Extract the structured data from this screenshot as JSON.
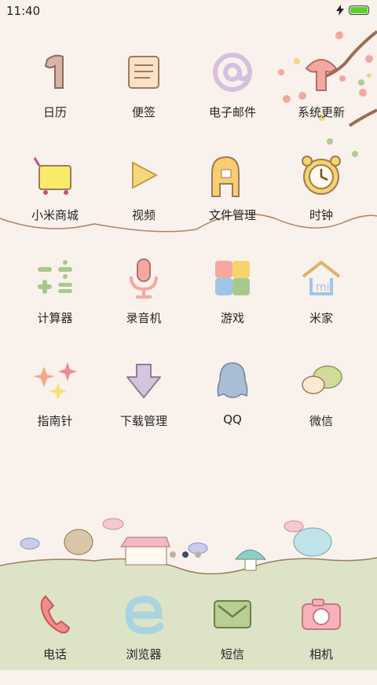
{
  "status": {
    "time": "11:40",
    "battery_level": 1.0,
    "charging": true
  },
  "pager": {
    "count": 3,
    "active_index": 1
  },
  "apps": [
    {
      "label": "日历",
      "icon": "calendar-icon"
    },
    {
      "label": "便签",
      "icon": "notes-icon"
    },
    {
      "label": "电子邮件",
      "icon": "email-icon"
    },
    {
      "label": "系统更新",
      "icon": "update-icon"
    },
    {
      "label": "小米商城",
      "icon": "mi-store-icon"
    },
    {
      "label": "视频",
      "icon": "video-icon"
    },
    {
      "label": "文件管理",
      "icon": "file-manager-icon"
    },
    {
      "label": "时钟",
      "icon": "clock-icon"
    },
    {
      "label": "计算器",
      "icon": "calculator-icon"
    },
    {
      "label": "录音机",
      "icon": "recorder-icon"
    },
    {
      "label": "游戏",
      "icon": "games-icon"
    },
    {
      "label": "米家",
      "icon": "mijia-icon"
    },
    {
      "label": "指南针",
      "icon": "compass-icon"
    },
    {
      "label": "下载管理",
      "icon": "download-icon"
    },
    {
      "label": "QQ",
      "icon": "qq-icon"
    },
    {
      "label": "微信",
      "icon": "wechat-icon"
    }
  ],
  "dock": [
    {
      "label": "电话",
      "icon": "phone-icon"
    },
    {
      "label": "浏览器",
      "icon": "browser-icon"
    },
    {
      "label": "短信",
      "icon": "messages-icon"
    },
    {
      "label": "相机",
      "icon": "camera-icon"
    }
  ],
  "colors": {
    "background": "#f9f1ec",
    "dock": "#dfe5cb",
    "hill_line": "#9d7a5b",
    "battery": "#5ad02f"
  }
}
